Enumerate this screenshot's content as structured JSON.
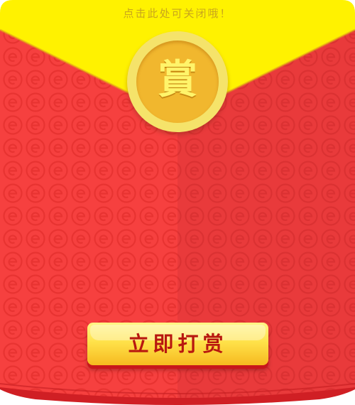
{
  "envelope": {
    "close_hint": "点击此处可关闭哦！",
    "coin_char": "賞",
    "tip_button_label": "立即打赏"
  },
  "colors": {
    "flap_yellow": "#fff200",
    "envelope_red_left": "#f6403f",
    "envelope_red_right": "#e93a3b",
    "coin_gold": "#f1b72e",
    "button_text": "#b8170f"
  },
  "icons": {
    "pattern": "e-circle-pattern",
    "coin": "reward-coin-icon"
  }
}
